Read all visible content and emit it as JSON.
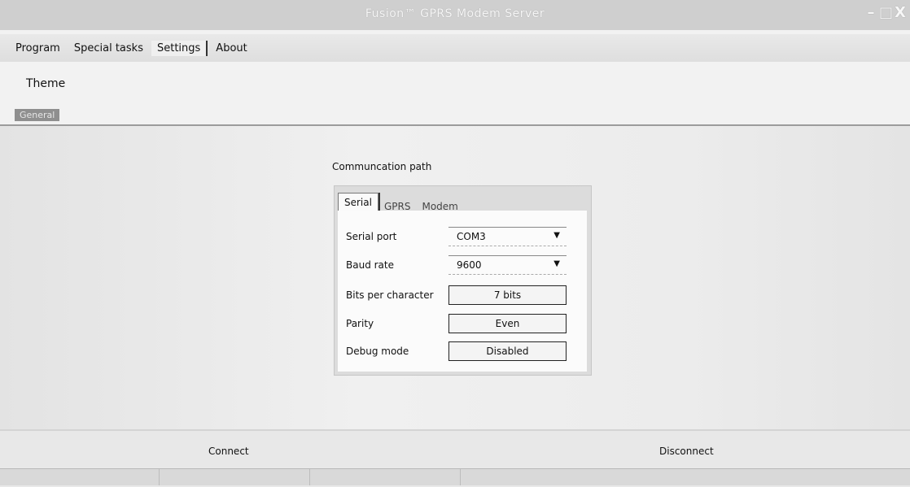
{
  "window": {
    "title": "Fusion™ GPRS Modem Server"
  },
  "window_controls": {
    "minimize": "–",
    "maximize": "□",
    "close": "X"
  },
  "menu": {
    "items": [
      "Program",
      "Special tasks",
      "Settings",
      "About"
    ],
    "active": "Settings"
  },
  "settings": {
    "theme_label": "Theme",
    "general_label": "General"
  },
  "communication": {
    "section_label": "Communcation path",
    "tabs": [
      "Serial",
      "GPRS",
      "Modem"
    ],
    "active_tab": "Serial",
    "serial_port": {
      "label": "Serial port",
      "value": "COM3"
    },
    "baud_rate": {
      "label": "Baud rate",
      "value": "9600"
    },
    "bits_per_character": {
      "label": "Bits per character",
      "value": "7 bits"
    },
    "parity": {
      "label": "Parity",
      "value": "Even"
    },
    "debug_mode": {
      "label": "Debug mode",
      "value": "Disabled"
    }
  },
  "actions": {
    "connect_label": "Connect",
    "disconnect_label": "Disconnect"
  },
  "icons": {
    "dropdown": "chevron-down-icon"
  }
}
